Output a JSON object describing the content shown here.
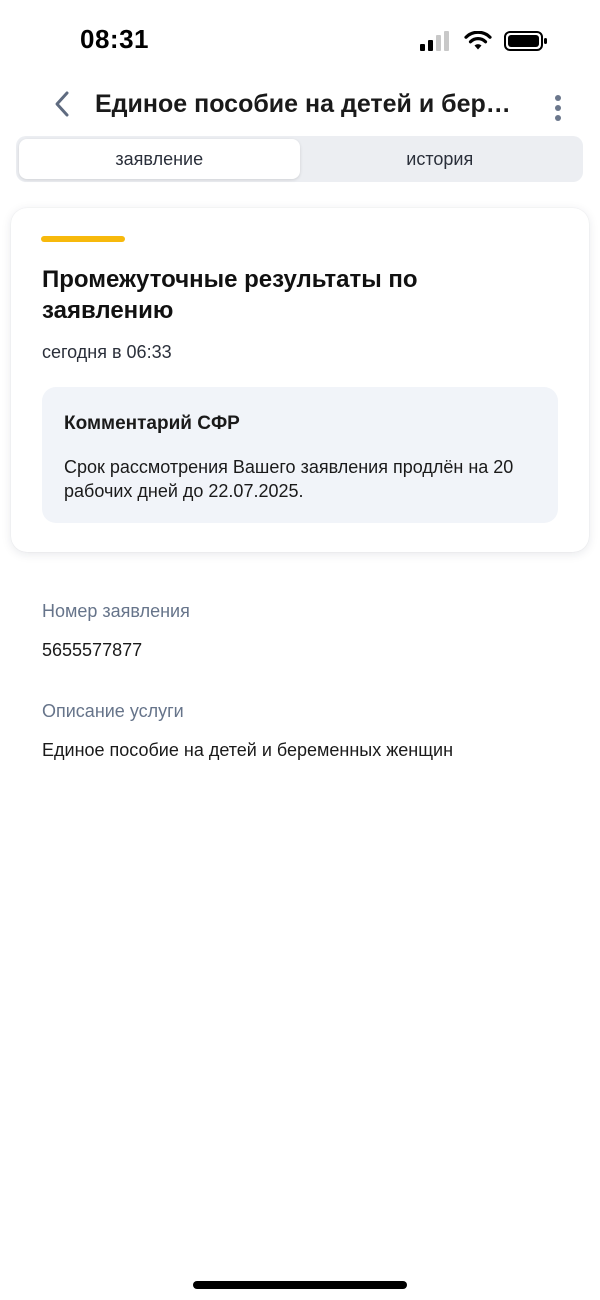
{
  "status_bar": {
    "time": "08:31"
  },
  "header": {
    "title": "Единое пособие на детей и бере...",
    "back_icon": "chevron-left-icon",
    "menu_icon": "more-vertical-icon"
  },
  "tabs": [
    {
      "label": "заявление",
      "active": true
    },
    {
      "label": "история",
      "active": false
    }
  ],
  "card": {
    "accent_color": "#f7b90c",
    "title": "Промежуточные результаты по заявлению",
    "date": "сегодня в 06:33",
    "comment": {
      "title": "Комментарий СФР",
      "text": "Срок рассмотрения Вашего заявления продлён на 20 рабочих дней до 22.07.2025."
    }
  },
  "fields": {
    "application_number": {
      "label": "Номер заявления",
      "value": "5655577877"
    },
    "service_description": {
      "label": "Описание услуги",
      "value": "Единое пособие на детей и беременных женщин"
    }
  }
}
